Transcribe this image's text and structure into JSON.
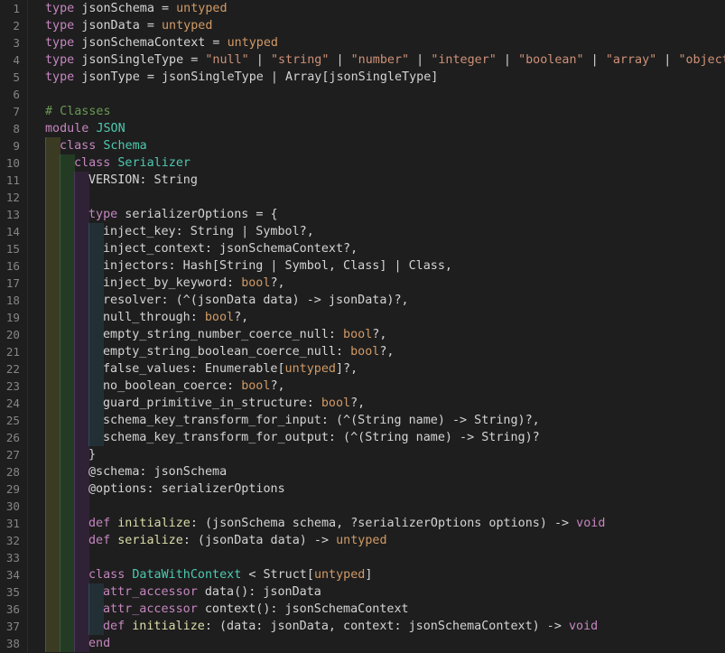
{
  "editor": {
    "lines": [
      {
        "n": "1",
        "indent": 0,
        "tokens": [
          [
            "kw",
            "type"
          ],
          [
            "id",
            " jsonSchema = "
          ],
          [
            "un",
            "untyped"
          ]
        ]
      },
      {
        "n": "2",
        "indent": 0,
        "tokens": [
          [
            "kw",
            "type"
          ],
          [
            "id",
            " jsonData = "
          ],
          [
            "un",
            "untyped"
          ]
        ]
      },
      {
        "n": "3",
        "indent": 0,
        "tokens": [
          [
            "kw",
            "type"
          ],
          [
            "id",
            " jsonSchemaContext = "
          ],
          [
            "un",
            "untyped"
          ]
        ]
      },
      {
        "n": "4",
        "indent": 0,
        "tokens": [
          [
            "kw",
            "type"
          ],
          [
            "id",
            " jsonSingleType = "
          ],
          [
            "str",
            "\"null\""
          ],
          [
            "id",
            " | "
          ],
          [
            "str",
            "\"string\""
          ],
          [
            "id",
            " | "
          ],
          [
            "str",
            "\"number\""
          ],
          [
            "id",
            " | "
          ],
          [
            "str",
            "\"integer\""
          ],
          [
            "id",
            " | "
          ],
          [
            "str",
            "\"boolean\""
          ],
          [
            "id",
            " | "
          ],
          [
            "str",
            "\"array\""
          ],
          [
            "id",
            " | "
          ],
          [
            "str",
            "\"object\""
          ]
        ]
      },
      {
        "n": "5",
        "indent": 0,
        "tokens": [
          [
            "kw",
            "type"
          ],
          [
            "id",
            " jsonType = jsonSingleType | Array[jsonSingleType]"
          ]
        ]
      },
      {
        "n": "6",
        "indent": 0,
        "tokens": []
      },
      {
        "n": "7",
        "indent": 0,
        "tokens": [
          [
            "cm",
            "# Classes"
          ]
        ]
      },
      {
        "n": "8",
        "indent": 0,
        "tokens": [
          [
            "kw",
            "module"
          ],
          [
            "id",
            " "
          ],
          [
            "ty",
            "JSON"
          ]
        ]
      },
      {
        "n": "9",
        "indent": 1,
        "tokens": [
          [
            "kw",
            "class"
          ],
          [
            "id",
            " "
          ],
          [
            "ty",
            "Schema"
          ]
        ]
      },
      {
        "n": "10",
        "indent": 2,
        "tokens": [
          [
            "kw",
            "class"
          ],
          [
            "id",
            " "
          ],
          [
            "ty",
            "Serializer"
          ]
        ]
      },
      {
        "n": "11",
        "indent": 3,
        "tokens": [
          [
            "id",
            "VERSION: String"
          ]
        ]
      },
      {
        "n": "12",
        "indent": 3,
        "tokens": []
      },
      {
        "n": "13",
        "indent": 3,
        "tokens": [
          [
            "kw",
            "type"
          ],
          [
            "id",
            " serializerOptions = {"
          ]
        ]
      },
      {
        "n": "14",
        "indent": 4,
        "tokens": [
          [
            "id",
            "inject_key: String | Symbol?,"
          ]
        ]
      },
      {
        "n": "15",
        "indent": 4,
        "tokens": [
          [
            "id",
            "inject_context: jsonSchemaContext?,"
          ]
        ]
      },
      {
        "n": "16",
        "indent": 4,
        "tokens": [
          [
            "id",
            "injectors: Hash[String | Symbol, Class] | Class,"
          ]
        ]
      },
      {
        "n": "17",
        "indent": 4,
        "tokens": [
          [
            "id",
            "inject_by_keyword: "
          ],
          [
            "bl",
            "bool"
          ],
          [
            "id",
            "?,"
          ]
        ]
      },
      {
        "n": "18",
        "indent": 4,
        "tokens": [
          [
            "id",
            "resolver: (^(jsonData data) -> jsonData)?,"
          ]
        ]
      },
      {
        "n": "19",
        "indent": 4,
        "tokens": [
          [
            "id",
            "null_through: "
          ],
          [
            "bl",
            "bool"
          ],
          [
            "id",
            "?,"
          ]
        ]
      },
      {
        "n": "20",
        "indent": 4,
        "tokens": [
          [
            "id",
            "empty_string_number_coerce_null: "
          ],
          [
            "bl",
            "bool"
          ],
          [
            "id",
            "?,"
          ]
        ]
      },
      {
        "n": "21",
        "indent": 4,
        "tokens": [
          [
            "id",
            "empty_string_boolean_coerce_null: "
          ],
          [
            "bl",
            "bool"
          ],
          [
            "id",
            "?,"
          ]
        ]
      },
      {
        "n": "22",
        "indent": 4,
        "tokens": [
          [
            "id",
            "false_values: Enumerable["
          ],
          [
            "un",
            "untyped"
          ],
          [
            "id",
            "]?,"
          ]
        ]
      },
      {
        "n": "23",
        "indent": 4,
        "tokens": [
          [
            "id",
            "no_boolean_coerce: "
          ],
          [
            "bl",
            "bool"
          ],
          [
            "id",
            "?,"
          ]
        ]
      },
      {
        "n": "24",
        "indent": 4,
        "tokens": [
          [
            "id",
            "guard_primitive_in_structure: "
          ],
          [
            "bl",
            "bool"
          ],
          [
            "id",
            "?,"
          ]
        ]
      },
      {
        "n": "25",
        "indent": 4,
        "tokens": [
          [
            "id",
            "schema_key_transform_for_input: (^(String name) -> String)?,"
          ]
        ]
      },
      {
        "n": "26",
        "indent": 4,
        "tokens": [
          [
            "id",
            "schema_key_transform_for_output: (^(String name) -> String)?"
          ]
        ]
      },
      {
        "n": "27",
        "indent": 3,
        "tokens": [
          [
            "id",
            "}"
          ]
        ]
      },
      {
        "n": "28",
        "indent": 3,
        "tokens": [
          [
            "id",
            "@schema: jsonSchema"
          ]
        ]
      },
      {
        "n": "29",
        "indent": 3,
        "tokens": [
          [
            "id",
            "@options: serializerOptions"
          ]
        ]
      },
      {
        "n": "30",
        "indent": 3,
        "tokens": []
      },
      {
        "n": "31",
        "indent": 3,
        "tokens": [
          [
            "kw",
            "def"
          ],
          [
            "id",
            " "
          ],
          [
            "fn",
            "initialize"
          ],
          [
            "id",
            ": (jsonSchema schema, ?serializerOptions options) -> "
          ],
          [
            "kw",
            "void"
          ]
        ]
      },
      {
        "n": "32",
        "indent": 3,
        "tokens": [
          [
            "kw",
            "def"
          ],
          [
            "id",
            " "
          ],
          [
            "fn",
            "serialize"
          ],
          [
            "id",
            ": (jsonData data) -> "
          ],
          [
            "un",
            "untyped"
          ]
        ]
      },
      {
        "n": "33",
        "indent": 3,
        "tokens": []
      },
      {
        "n": "34",
        "indent": 3,
        "tokens": [
          [
            "kw",
            "class"
          ],
          [
            "id",
            " "
          ],
          [
            "ty",
            "DataWithContext"
          ],
          [
            "id",
            " < Struct["
          ],
          [
            "un",
            "untyped"
          ],
          [
            "id",
            "]"
          ]
        ]
      },
      {
        "n": "35",
        "indent": 4,
        "tokens": [
          [
            "kw",
            "attr_accessor"
          ],
          [
            "id",
            " data(): jsonData"
          ]
        ]
      },
      {
        "n": "36",
        "indent": 4,
        "tokens": [
          [
            "kw",
            "attr_accessor"
          ],
          [
            "id",
            " context(): jsonSchemaContext"
          ]
        ]
      },
      {
        "n": "37",
        "indent": 4,
        "tokens": [
          [
            "kw",
            "def"
          ],
          [
            "id",
            " "
          ],
          [
            "fn",
            "initialize"
          ],
          [
            "id",
            ": (data: jsonData, context: jsonSchemaContext) -> "
          ],
          [
            "kw",
            "void"
          ]
        ]
      },
      {
        "n": "38",
        "indent": 3,
        "tokens": [
          [
            "kw",
            "end"
          ]
        ]
      }
    ]
  }
}
